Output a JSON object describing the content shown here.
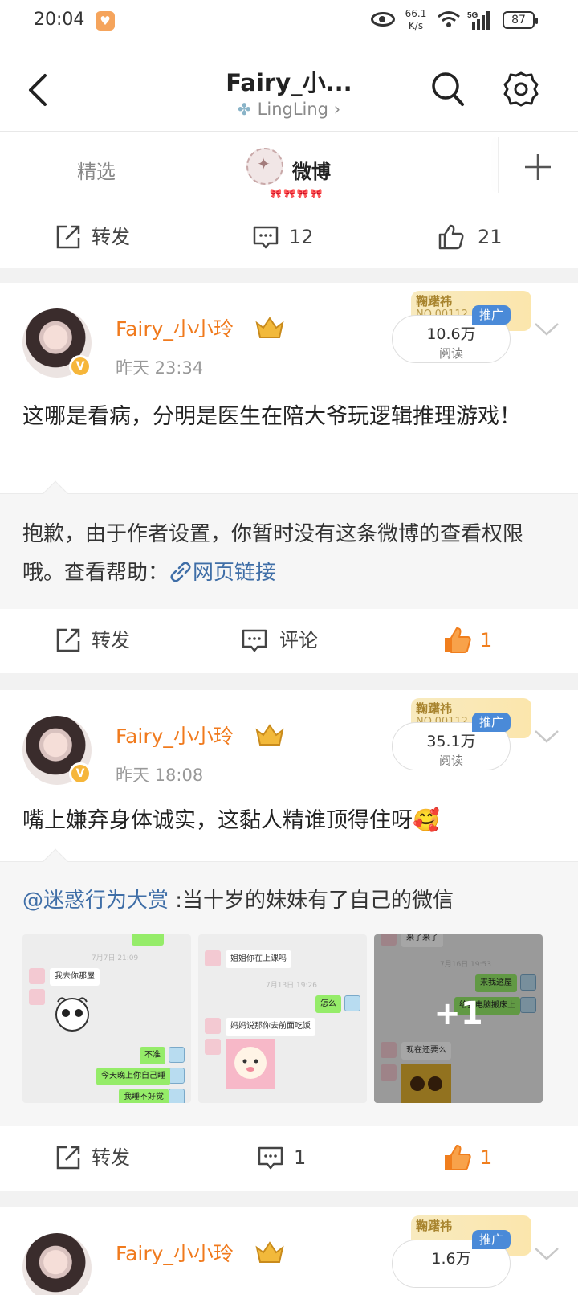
{
  "status_bar": {
    "time": "20:04",
    "net_speed_value": "66.1",
    "net_speed_unit": "K/s",
    "network_type": "5G",
    "battery": "87"
  },
  "header": {
    "title": "Fairy_小...",
    "subtitle": "LingLing",
    "subtitle_chevron": "›"
  },
  "tabs": {
    "items": [
      "精选",
      "微博"
    ],
    "active": "微博",
    "decor_text": "🎀🎀🎀🎀"
  },
  "top_action_bar": {
    "repost_label": "转发",
    "comment_count": "12",
    "like_count": "21"
  },
  "posts": [
    {
      "username": "Fairy_小小玲",
      "time": "昨天 23:34",
      "promo_word": "鞠躇祎",
      "promo_number": "NO.00112",
      "promo_tag": "推广",
      "reads_value": "10.6万",
      "reads_label": "阅读",
      "text": "这哪是看病，分明是医生在陪大爷玩逻辑推理游戏！",
      "quote_text": "抱歉，由于作者设置，你暂时没有这条微博的查看权限哦。查看帮助：",
      "quote_link": "网页链接",
      "actions": {
        "repost_label": "转发",
        "comment_label": "评论",
        "like_count": "1"
      }
    },
    {
      "username": "Fairy_小小玲",
      "time": "昨天 18:08",
      "promo_word": "鞠躇祎",
      "promo_number": "NO.00112",
      "promo_tag": "推广",
      "reads_value": "35.1万",
      "reads_label": "阅读",
      "text": "嘴上嫌弃身体诚实，这黏人精谁顶得住呀🥰",
      "quote_mention": "@迷惑行为大赏",
      "quote_text": " :当十岁的妹妹有了自己的微信",
      "images": [
        {
          "stamp": "7月7日 21:09",
          "bubbles": [
            "我去你那屋",
            "不准",
            "今天晚上你自己睡",
            "我睡不好觉"
          ]
        },
        {
          "stamp": "7月13日 19:26",
          "bubbles": [
            "姐姐你在上课吗",
            "怎么",
            "妈妈说那你去前面吃饭"
          ]
        },
        {
          "stamp": "7月16日 19:53",
          "bubbles": [
            "来了来了",
            "来我这屋",
            "给我电脑搬床上",
            "现在还要么"
          ]
        }
      ],
      "more_images": "+1",
      "actions": {
        "repost_label": "转发",
        "comment_count": "1",
        "like_count": "1"
      }
    },
    {
      "username": "Fairy_小小玲",
      "promo_word": "鞠躇祎",
      "promo_tag": "推广",
      "reads_value": "1.6万"
    }
  ],
  "colors": {
    "username": "#f07a1d",
    "link": "#3f6ea7",
    "promo_tag": "#4a8ad8",
    "like_active": "#f07e1d"
  }
}
